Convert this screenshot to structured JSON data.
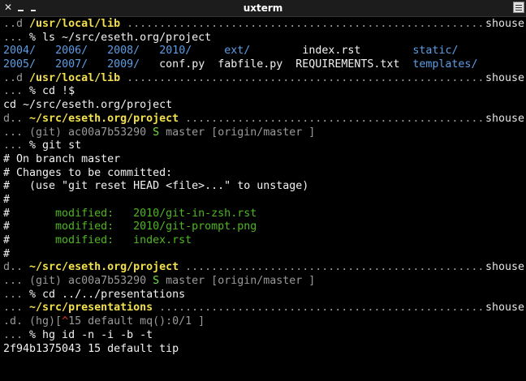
{
  "window": {
    "title": "uxterm",
    "close_glyph": "✕",
    "minimize_label": "",
    "maximize_label": ""
  },
  "terminal": {
    "lines": [
      {
        "segs": [
          {
            "t": "..d ",
            "c": "c-dim"
          },
          {
            "t": "/usr/local/lib",
            "c": "c-yellow"
          },
          {
            "t": " .......................................................",
            "c": "c-dim"
          }
        ],
        "right": "shouse"
      },
      {
        "segs": [
          {
            "t": "... ",
            "c": "c-dim"
          },
          {
            "t": "% ls ~/src/eseth.org/project",
            "c": "c-white"
          }
        ],
        "right": ""
      },
      {
        "segs": [
          {
            "t": "2004/",
            "c": "c-blue"
          },
          {
            "t": "   ",
            "c": ""
          },
          {
            "t": "2006/",
            "c": "c-blue"
          },
          {
            "t": "   ",
            "c": ""
          },
          {
            "t": "2008/",
            "c": "c-blue"
          },
          {
            "t": "   ",
            "c": ""
          },
          {
            "t": "2010/",
            "c": "c-blue"
          },
          {
            "t": "     ",
            "c": ""
          },
          {
            "t": "ext/",
            "c": "c-blue"
          },
          {
            "t": "        index.rst        ",
            "c": "c-white"
          },
          {
            "t": "static/",
            "c": "c-blue"
          }
        ],
        "right": ""
      },
      {
        "segs": [
          {
            "t": "2005/",
            "c": "c-blue"
          },
          {
            "t": "   ",
            "c": ""
          },
          {
            "t": "2007/",
            "c": "c-blue"
          },
          {
            "t": "   ",
            "c": ""
          },
          {
            "t": "2009/",
            "c": "c-blue"
          },
          {
            "t": "   conf.py  fabfile.py  REQUIREMENTS.txt  ",
            "c": "c-white"
          },
          {
            "t": "templates/",
            "c": "c-blue"
          }
        ],
        "right": ""
      },
      {
        "segs": [
          {
            "t": "..d ",
            "c": "c-dim"
          },
          {
            "t": "/usr/local/lib",
            "c": "c-yellow"
          },
          {
            "t": " .......................................................",
            "c": "c-dim"
          }
        ],
        "right": "shouse"
      },
      {
        "segs": [
          {
            "t": "... ",
            "c": "c-dim"
          },
          {
            "t": "% cd !$",
            "c": "c-white"
          }
        ],
        "right": ""
      },
      {
        "segs": [
          {
            "t": "cd ~/src/eseth.org/project",
            "c": "c-white"
          }
        ],
        "right": ""
      },
      {
        "segs": [
          {
            "t": "d.. ",
            "c": "c-dim"
          },
          {
            "t": "~/src/eseth.org/project",
            "c": "c-yellow"
          },
          {
            "t": " ..............................................",
            "c": "c-dim"
          }
        ],
        "right": "shouse"
      },
      {
        "segs": [
          {
            "t": "... (git) ac00a7b53290 ",
            "c": "c-dim"
          },
          {
            "t": "S",
            "c": "c-bgreen"
          },
          {
            "t": " master [origin/master ]",
            "c": "c-dim"
          }
        ],
        "right": ""
      },
      {
        "segs": [
          {
            "t": "... ",
            "c": "c-dim"
          },
          {
            "t": "% git st",
            "c": "c-white"
          }
        ],
        "right": ""
      },
      {
        "segs": [
          {
            "t": "# On branch master",
            "c": "c-white"
          }
        ],
        "right": ""
      },
      {
        "segs": [
          {
            "t": "# Changes to be committed:",
            "c": "c-white"
          }
        ],
        "right": ""
      },
      {
        "segs": [
          {
            "t": "#   (use \"git reset HEAD <file>...\" to unstage)",
            "c": "c-white"
          }
        ],
        "right": ""
      },
      {
        "segs": [
          {
            "t": "#",
            "c": "c-white"
          }
        ],
        "right": ""
      },
      {
        "segs": [
          {
            "t": "#       ",
            "c": "c-white"
          },
          {
            "t": "modified:   2010/git-in-zsh.rst",
            "c": "c-green"
          }
        ],
        "right": ""
      },
      {
        "segs": [
          {
            "t": "#       ",
            "c": "c-white"
          },
          {
            "t": "modified:   2010/git-prompt.png",
            "c": "c-green"
          }
        ],
        "right": ""
      },
      {
        "segs": [
          {
            "t": "#       ",
            "c": "c-white"
          },
          {
            "t": "modified:   index.rst",
            "c": "c-green"
          }
        ],
        "right": ""
      },
      {
        "segs": [
          {
            "t": "#",
            "c": "c-white"
          }
        ],
        "right": ""
      },
      {
        "segs": [
          {
            "t": "d.. ",
            "c": "c-dim"
          },
          {
            "t": "~/src/eseth.org/project",
            "c": "c-yellow"
          },
          {
            "t": " ..............................................",
            "c": "c-dim"
          }
        ],
        "right": "shouse"
      },
      {
        "segs": [
          {
            "t": "... (git) ac00a7b53290 ",
            "c": "c-dim"
          },
          {
            "t": "S",
            "c": "c-bgreen"
          },
          {
            "t": " master [origin/master ]",
            "c": "c-dim"
          }
        ],
        "right": ""
      },
      {
        "segs": [
          {
            "t": "... ",
            "c": "c-dim"
          },
          {
            "t": "% cd ../../presentations",
            "c": "c-white"
          }
        ],
        "right": ""
      },
      {
        "segs": [
          {
            "t": "... ",
            "c": "c-dim"
          },
          {
            "t": "~/src/presentations",
            "c": "c-yellow"
          },
          {
            "t": " ..................................................",
            "c": "c-dim"
          }
        ],
        "right": "shouse"
      },
      {
        "segs": [
          {
            "t": ".d. (hg)[",
            "c": "c-dim"
          },
          {
            "t": "^",
            "c": "c-red"
          },
          {
            "t": "15 default mq():0/1 ]",
            "c": "c-dim"
          }
        ],
        "right": ""
      },
      {
        "segs": [
          {
            "t": "... ",
            "c": "c-dim"
          },
          {
            "t": "% hg id -n -i -b -t",
            "c": "c-white"
          }
        ],
        "right": ""
      },
      {
        "segs": [
          {
            "t": "2f94b1375043 15 default tip",
            "c": "c-white"
          }
        ],
        "right": ""
      }
    ]
  }
}
